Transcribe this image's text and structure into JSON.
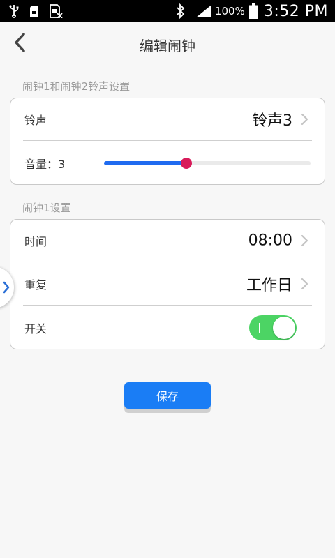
{
  "status_bar": {
    "battery_percent": "100%",
    "time": "3:52 PM",
    "icons": [
      "usb-icon",
      "sd-card-icon",
      "no-sim-icon",
      "bluetooth-icon",
      "signal-icon",
      "battery-icon"
    ]
  },
  "header": {
    "title": "编辑闹钟",
    "back_icon": "chevron-left-icon"
  },
  "ringtone_section": {
    "label": "闹钟1和闹钟2铃声设置",
    "ringtone_label": "铃声",
    "ringtone_value": "铃声3",
    "volume_label": "音量：3",
    "volume_level_fraction": 0.4
  },
  "alarm1_section": {
    "label": "闹钟1设置",
    "time_label": "时间",
    "time_value": "08:00",
    "repeat_label": "重复",
    "repeat_value": "工作日",
    "switch_label": "开关",
    "switch_on": true
  },
  "save_label": "保存",
  "colors": {
    "accent_blue": "#1a7df5",
    "slider_fill": "#1f6bf0",
    "slider_thumb": "#d81b5a",
    "toggle_on": "#4cd464"
  }
}
